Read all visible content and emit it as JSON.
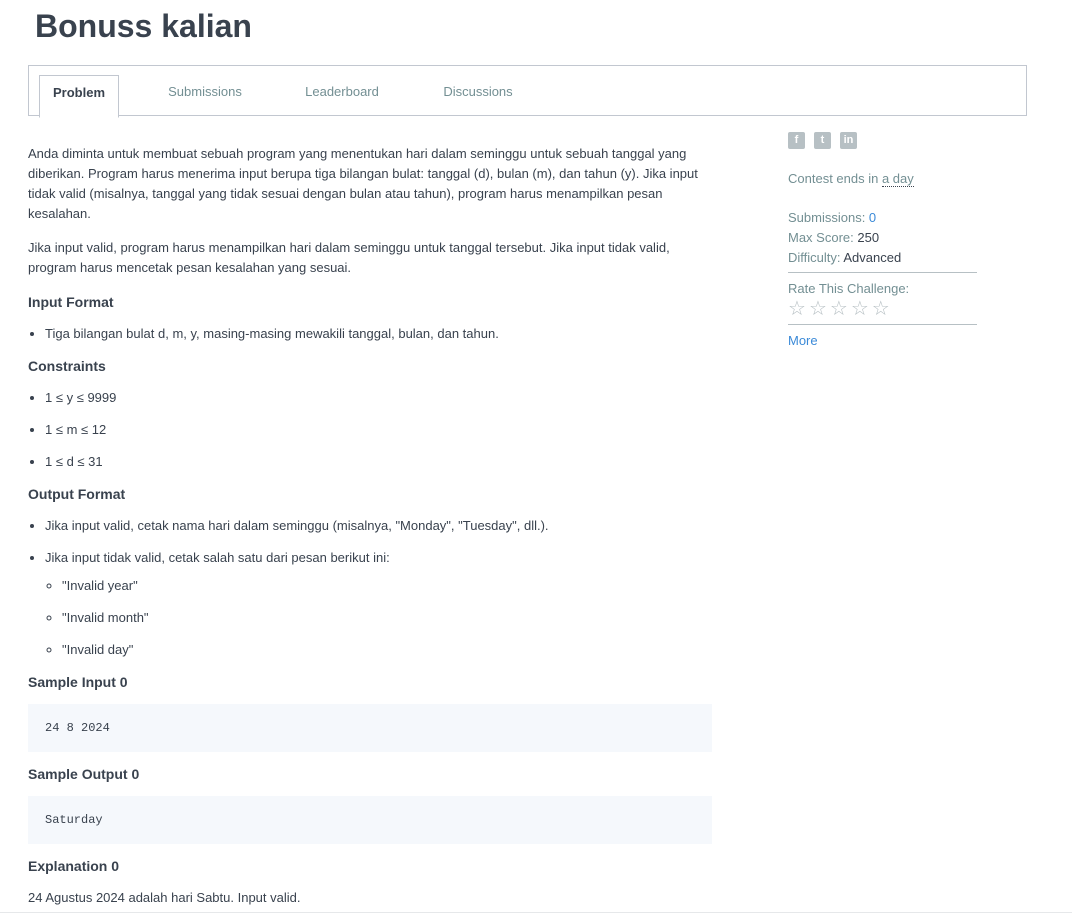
{
  "page": {
    "title": "Bonuss kalian"
  },
  "tabs": [
    {
      "label": "Problem"
    },
    {
      "label": "Submissions"
    },
    {
      "label": "Leaderboard"
    },
    {
      "label": "Discussions"
    }
  ],
  "problem": {
    "intro_1": "Anda diminta untuk membuat sebuah program yang menentukan hari dalam seminggu untuk sebuah tanggal yang diberikan. Program harus menerima input berupa tiga bilangan bulat: tanggal (d), bulan (m), dan tahun (y). Jika input tidak valid (misalnya, tanggal yang tidak sesuai dengan bulan atau tahun), program harus menampilkan pesan kesalahan.",
    "intro_2": "Jika input valid, program harus menampilkan hari dalam seminggu untuk tanggal tersebut. Jika input tidak valid, program harus mencetak pesan kesalahan yang sesuai.",
    "input_format": {
      "heading": "Input Format",
      "items": [
        "Tiga bilangan bulat d, m, y, masing-masing mewakili tanggal, bulan, dan tahun."
      ]
    },
    "constraints": {
      "heading": "Constraints",
      "items": [
        "1 ≤ y ≤ 9999",
        "1 ≤ m ≤ 12",
        "1 ≤ d ≤ 31"
      ]
    },
    "output_format": {
      "heading": "Output Format",
      "items": [
        "Jika input valid, cetak nama hari dalam seminggu (misalnya, \"Monday\", \"Tuesday\", dll.).",
        "Jika input tidak valid, cetak salah satu dari pesan berikut ini:"
      ],
      "sub_items": [
        "\"Invalid year\"",
        "\"Invalid month\"",
        "\"Invalid day\""
      ]
    },
    "sample_input": {
      "heading": "Sample Input 0",
      "value": "24 8 2024"
    },
    "sample_output": {
      "heading": "Sample Output 0",
      "value": "Saturday"
    },
    "explanation": {
      "heading": "Explanation 0",
      "text": "24 Agustus 2024 adalah hari Sabtu. Input valid."
    }
  },
  "sidebar": {
    "social": [
      {
        "icon": "facebook-icon",
        "glyph": "f"
      },
      {
        "icon": "twitter-icon",
        "glyph": "t"
      },
      {
        "icon": "linkedin-icon",
        "glyph": "in"
      }
    ],
    "contest_ends_prefix": "Contest ends in ",
    "contest_ends_time": "a day",
    "submissions_label": "Submissions: ",
    "submissions_value": "0",
    "max_score_label": "Max Score: ",
    "max_score_value": "250",
    "difficulty_label": "Difficulty: ",
    "difficulty_value": "Advanced",
    "rate_label": "Rate This Challenge:",
    "stars": [
      "☆",
      "☆",
      "☆",
      "☆",
      "☆"
    ],
    "more_label": "More"
  }
}
